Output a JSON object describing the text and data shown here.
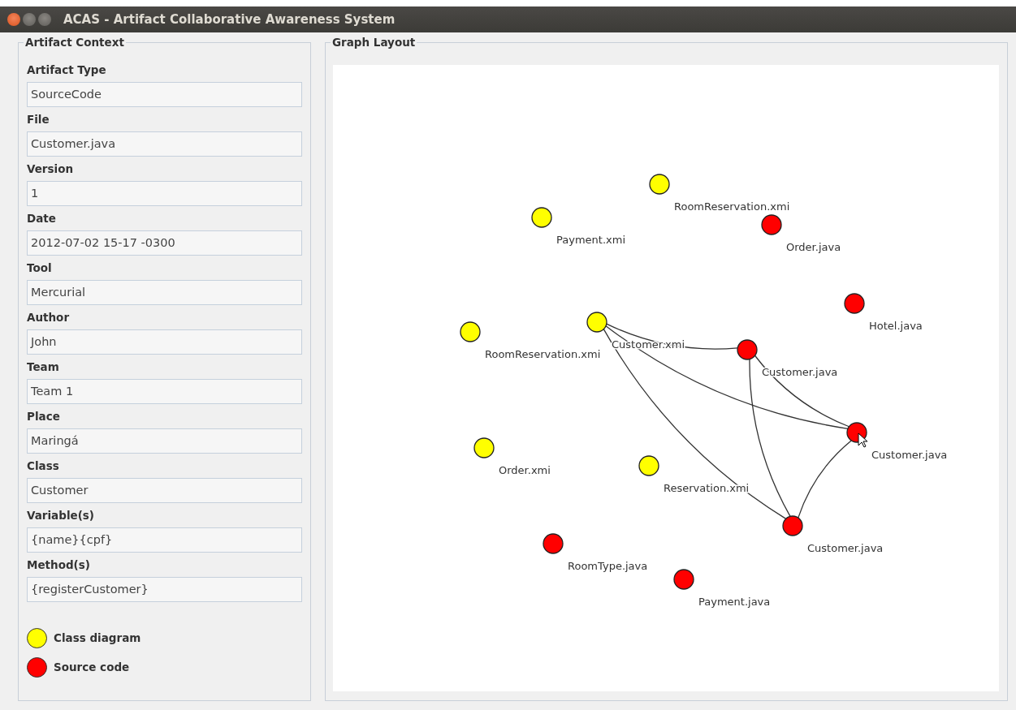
{
  "window": {
    "title": "ACAS - Artifact Collaborative Awareness System"
  },
  "artifact_context": {
    "title": "Artifact Context",
    "fields": [
      {
        "label": "Artifact Type",
        "value": "SourceCode"
      },
      {
        "label": "File",
        "value": "Customer.java"
      },
      {
        "label": "Version",
        "value": "1"
      },
      {
        "label": "Date",
        "value": "2012-07-02 15-17 -0300"
      },
      {
        "label": "Tool",
        "value": "Mercurial"
      },
      {
        "label": "Author",
        "value": "John"
      },
      {
        "label": "Team",
        "value": "Team 1"
      },
      {
        "label": "Place",
        "value": "Maringá"
      },
      {
        "label": "Class",
        "value": "Customer"
      },
      {
        "label": "Variable(s)",
        "value": "{name}{cpf}"
      },
      {
        "label": "Method(s)",
        "value": "{registerCustomer}"
      }
    ],
    "legend": [
      {
        "label": "Class diagram",
        "color": "#ffff00"
      },
      {
        "label": "Source code",
        "color": "#ff0000"
      }
    ]
  },
  "graph_layout": {
    "title": "Graph Layout",
    "nodes": [
      {
        "label": "RoomReservation.xmi",
        "color": "#ffff00"
      },
      {
        "label": "Order.java",
        "color": "#ff0000"
      },
      {
        "label": "Payment.xmi",
        "color": "#ffff00"
      },
      {
        "label": "Hotel.java",
        "color": "#ff0000"
      },
      {
        "label": "RoomReservation.xmi",
        "color": "#ffff00"
      },
      {
        "label": "Customer.xmi",
        "color": "#ffff00"
      },
      {
        "label": "Customer.java",
        "color": "#ff0000"
      },
      {
        "label": "Customer.java",
        "color": "#ff0000",
        "selected": true
      },
      {
        "label": "Order.xmi",
        "color": "#ffff00"
      },
      {
        "label": "Reservation.xmi",
        "color": "#ffff00"
      },
      {
        "label": "Customer.java",
        "color": "#ff0000"
      },
      {
        "label": "RoomType.java",
        "color": "#ff0000"
      },
      {
        "label": "Payment.java",
        "color": "#ff0000"
      }
    ]
  }
}
